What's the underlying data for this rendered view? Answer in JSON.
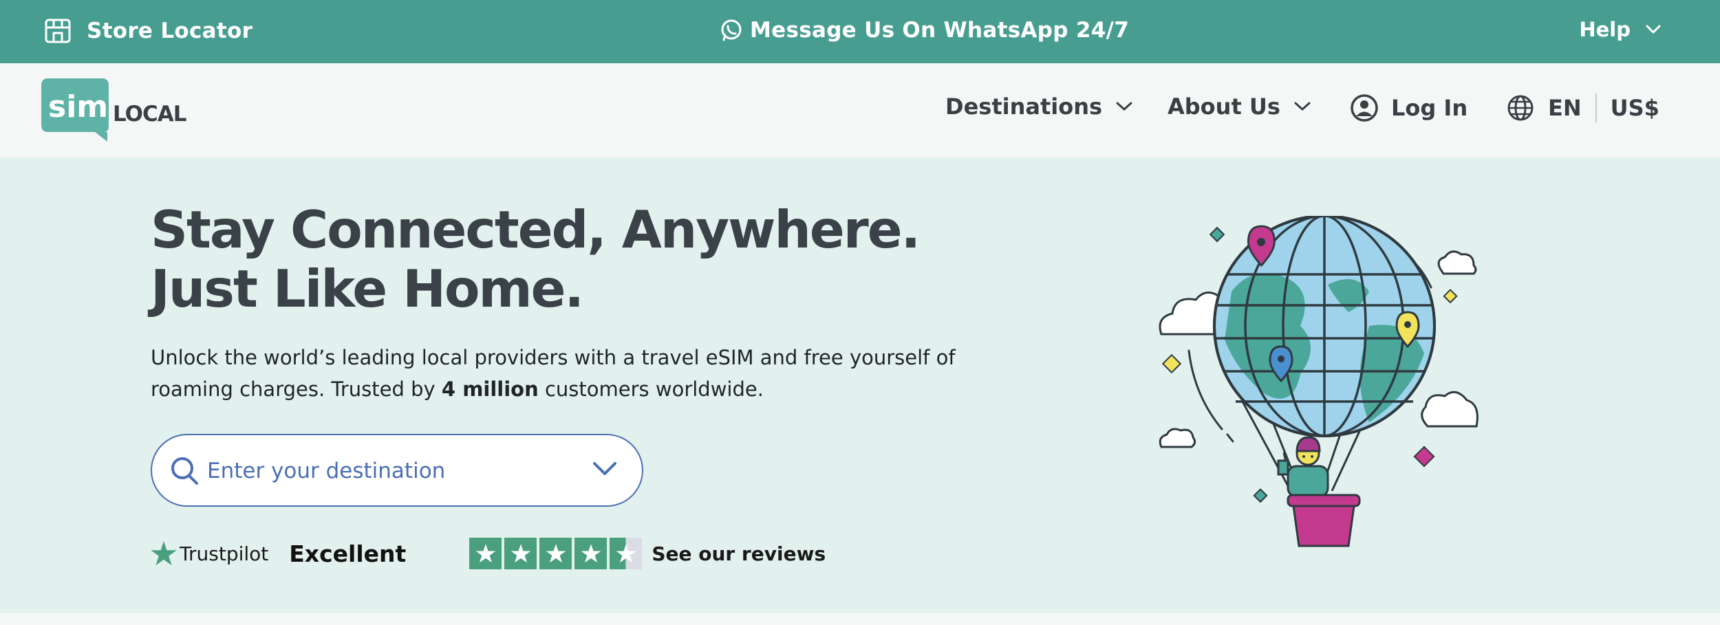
{
  "topbar": {
    "store_locator": "Store Locator",
    "whatsapp": "Message Us On WhatsApp 24/7",
    "help": "Help",
    "icons": [
      "store-icon",
      "whatsapp-icon",
      "chevron-down-icon"
    ]
  },
  "header": {
    "logo_sim": "sim",
    "logo_local": "LOCAL",
    "nav": {
      "destinations": "Destinations",
      "about": "About Us",
      "login": "Log In",
      "lang": "EN",
      "currency": "US$"
    }
  },
  "hero": {
    "headline": "Stay Connected, Anywhere.  Just Like Home.",
    "sub_before": "Unlock the world’s leading local providers with a travel eSIM and free yourself of roaming charges. Trusted by ",
    "sub_bold": "4 million",
    "sub_after": " customers worldwide.",
    "search_placeholder": "Enter your destination",
    "trustpilot": "Trustpilot",
    "rating_text": "Excellent",
    "rating_stars": 4.5,
    "reviews_link": "See our reviews"
  },
  "colors": {
    "topbar": "#479e90",
    "hero_bg": "#e2f0ee",
    "search_border": "#4a6fb5",
    "star_green": "#4aa07e",
    "headline": "#3a4147"
  }
}
